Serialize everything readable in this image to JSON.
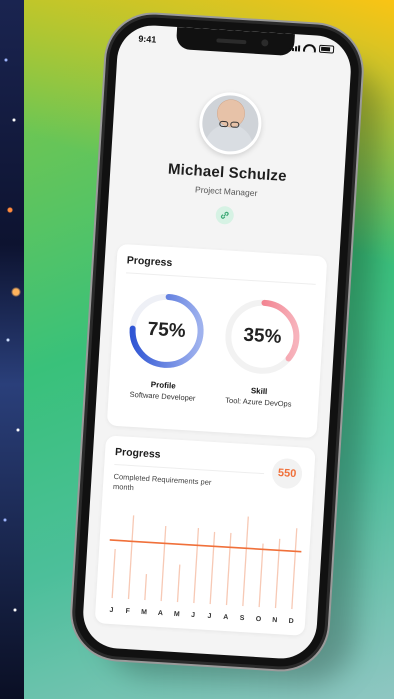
{
  "status": {
    "time": "9:41"
  },
  "profile": {
    "name": "Michael Schulze",
    "role": "Project Manager",
    "link_icon": "link-icon"
  },
  "progress_card": {
    "title": "Progress",
    "rings": [
      {
        "value_text": "75%",
        "fraction": 0.75,
        "label": "Profile",
        "sublabel": "Software Developer",
        "color": "#2f55d4"
      },
      {
        "value_text": "35%",
        "fraction": 0.35,
        "label": "Skill",
        "sublabel": "Tool: Azure DevOps",
        "color": "#ee5a6b"
      }
    ]
  },
  "requirements_card": {
    "title": "Progress",
    "badge": "550",
    "subtitle": "Completed Requirements per month",
    "accent": "#f0703a"
  },
  "chart_data": {
    "type": "bar",
    "title": "",
    "xlabel": "",
    "ylabel": "",
    "categories": [
      "J",
      "F",
      "M",
      "A",
      "M",
      "J",
      "J",
      "A",
      "S",
      "O",
      "N",
      "D"
    ],
    "values": [
      34,
      58,
      18,
      52,
      26,
      52,
      50,
      50,
      62,
      44,
      48,
      56
    ],
    "average": 40,
    "ylim": [
      0,
      65
    ],
    "grid": false
  }
}
